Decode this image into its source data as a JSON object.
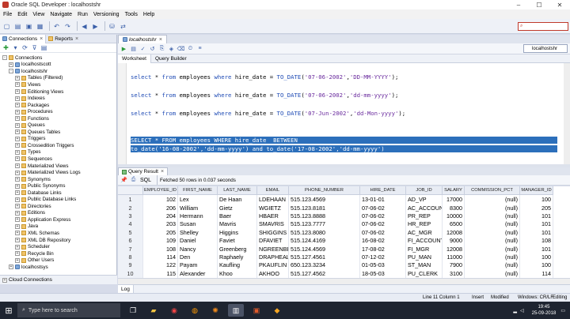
{
  "window": {
    "title": "Oracle SQL Developer : localhostshr",
    "controls": [
      "minimize-icon",
      "maximize-icon",
      "close-icon"
    ]
  },
  "menu": [
    "File",
    "Edit",
    "View",
    "Navigate",
    "Run",
    "Versioning",
    "Tools",
    "Help"
  ],
  "search": {
    "placeholder": ""
  },
  "left_panel": {
    "tabs": [
      {
        "label": "Connections"
      },
      {
        "label": "Reports"
      }
    ],
    "tree": [
      {
        "label": "Connections",
        "level": 0,
        "expander": "-",
        "icon": "folder-icon"
      },
      {
        "label": "localhostscott",
        "level": 1,
        "expander": "+",
        "icon": "database-connection-icon"
      },
      {
        "label": "localhostshr",
        "level": 1,
        "expander": "-",
        "icon": "database-connection-icon"
      },
      {
        "label": "Tables (Filtered)",
        "level": 2,
        "expander": "+",
        "icon": "folder-icon"
      },
      {
        "label": "Views",
        "level": 2,
        "expander": "+",
        "icon": "folder-icon"
      },
      {
        "label": "Editioning Views",
        "level": 2,
        "expander": "+",
        "icon": "folder-icon"
      },
      {
        "label": "Indexes",
        "level": 2,
        "expander": "+",
        "icon": "folder-icon"
      },
      {
        "label": "Packages",
        "level": 2,
        "expander": "+",
        "icon": "folder-icon"
      },
      {
        "label": "Procedures",
        "level": 2,
        "expander": "+",
        "icon": "folder-icon"
      },
      {
        "label": "Functions",
        "level": 2,
        "expander": "+",
        "icon": "folder-icon"
      },
      {
        "label": "Queues",
        "level": 2,
        "expander": "+",
        "icon": "folder-icon"
      },
      {
        "label": "Queues Tables",
        "level": 2,
        "expander": "+",
        "icon": "folder-icon"
      },
      {
        "label": "Triggers",
        "level": 2,
        "expander": "+",
        "icon": "folder-icon"
      },
      {
        "label": "Crossedition Triggers",
        "level": 2,
        "expander": "+",
        "icon": "folder-icon"
      },
      {
        "label": "Types",
        "level": 2,
        "expander": "+",
        "icon": "folder-icon"
      },
      {
        "label": "Sequences",
        "level": 2,
        "expander": "+",
        "icon": "folder-icon"
      },
      {
        "label": "Materialized Views",
        "level": 2,
        "expander": "+",
        "icon": "folder-icon"
      },
      {
        "label": "Materialized Views Logs",
        "level": 2,
        "expander": "+",
        "icon": "folder-icon"
      },
      {
        "label": "Synonyms",
        "level": 2,
        "expander": "+",
        "icon": "folder-icon"
      },
      {
        "label": "Public Synonyms",
        "level": 2,
        "expander": "+",
        "icon": "folder-icon"
      },
      {
        "label": "Database Links",
        "level": 2,
        "expander": "+",
        "icon": "folder-icon"
      },
      {
        "label": "Public Database Links",
        "level": 2,
        "expander": "+",
        "icon": "folder-icon"
      },
      {
        "label": "Directories",
        "level": 2,
        "expander": "+",
        "icon": "folder-icon"
      },
      {
        "label": "Editions",
        "level": 2,
        "expander": "+",
        "icon": "folder-icon"
      },
      {
        "label": "Application Express",
        "level": 2,
        "expander": "+",
        "icon": "folder-icon"
      },
      {
        "label": "Java",
        "level": 2,
        "expander": "+",
        "icon": "folder-icon"
      },
      {
        "label": "XML Schemas",
        "level": 2,
        "expander": "+",
        "icon": "folder-icon"
      },
      {
        "label": "XML DB Repository",
        "level": 2,
        "expander": "+",
        "icon": "folder-icon"
      },
      {
        "label": "Scheduler",
        "level": 2,
        "expander": "+",
        "icon": "folder-icon"
      },
      {
        "label": "Recycle Bin",
        "level": 2,
        "expander": "+",
        "icon": "folder-icon"
      },
      {
        "label": "Other Users",
        "level": 2,
        "expander": "+",
        "icon": "folder-icon"
      },
      {
        "label": "localhostsys",
        "level": 1,
        "expander": "+",
        "icon": "database-connection-icon"
      }
    ],
    "bottom_label": "Cloud Connections"
  },
  "editor": {
    "tab_label": "localhostshr",
    "connection": "localhostshr",
    "subtabs": [
      "Worksheet",
      "Query Builder"
    ],
    "lines": [
      {
        "parts": [
          [
            "kw",
            "select"
          ],
          [
            "t",
            " * "
          ],
          [
            "kw",
            "from"
          ],
          [
            "t",
            " employees "
          ],
          [
            "kw",
            "where"
          ],
          [
            "t",
            " hire_date = "
          ],
          [
            "kw",
            "TO_DATE"
          ],
          [
            "t",
            "("
          ],
          [
            "str",
            "'07-06-2002'"
          ],
          [
            "t",
            ","
          ],
          [
            "str",
            "'DD-MM-YYYY'"
          ],
          [
            "t",
            ");"
          ]
        ]
      },
      {
        "parts": [
          [
            "kw",
            "select"
          ],
          [
            "t",
            " * "
          ],
          [
            "kw",
            "from"
          ],
          [
            "t",
            " employees "
          ],
          [
            "kw",
            "where"
          ],
          [
            "t",
            " hire_date = "
          ],
          [
            "kw",
            "TO_DATE"
          ],
          [
            "t",
            "("
          ],
          [
            "str",
            "'07-06-2002'"
          ],
          [
            "t",
            ","
          ],
          [
            "str",
            "'dd-mm-yyyy'"
          ],
          [
            "t",
            ");"
          ]
        ]
      },
      {
        "parts": [
          [
            "kw",
            "select"
          ],
          [
            "t",
            " * "
          ],
          [
            "kw",
            "from"
          ],
          [
            "t",
            " employees "
          ],
          [
            "kw",
            "where"
          ],
          [
            "t",
            " hire_date = "
          ],
          [
            "kw",
            "TO_DATE"
          ],
          [
            "t",
            "("
          ],
          [
            "str",
            "'07-Jun-2002'"
          ],
          [
            "t",
            ","
          ],
          [
            "str",
            "'dd-Mon-yyyy'"
          ],
          [
            "t",
            ");"
          ]
        ]
      },
      {
        "selected": true,
        "parts": [
          [
            "t",
            "SELECT * FROM employees WHERE hire_date  BETWEEN"
          ]
        ]
      },
      {
        "selected": true,
        "parts": [
          [
            "t",
            "to_date('16-08-2002','dd-mm-yyyy') and to_date('17-08-2002','dd-mm-yyyy')"
          ]
        ]
      }
    ]
  },
  "results": {
    "tab_label": "Query Result",
    "toolbar_sql": "SQL",
    "status": "Fetched 50 rows in 0.037 seconds",
    "columns": [
      "EMPLOYEE_ID",
      "FIRST_NAME",
      "LAST_NAME",
      "EMAIL",
      "PHONE_NUMBER",
      "HIRE_DATE",
      "JOB_ID",
      "SALARY",
      "COMMISSION_PCT",
      "MANAGER_ID"
    ],
    "rows": [
      [
        "1",
        "102",
        "Lex",
        "De Haan",
        "LDEHAAN",
        "515.123.4569",
        "13-01-01",
        "AD_VP",
        "17000",
        "(null)",
        "100"
      ],
      [
        "2",
        "206",
        "William",
        "Gietz",
        "WGIETZ",
        "515.123.8181",
        "07-06-02",
        "AC_ACCOUNT",
        "8300",
        "(null)",
        "205"
      ],
      [
        "3",
        "204",
        "Hermann",
        "Baer",
        "HBAER",
        "515.123.8888",
        "07-06-02",
        "PR_REP",
        "10000",
        "(null)",
        "101"
      ],
      [
        "4",
        "203",
        "Susan",
        "Mavris",
        "SMAVRIS",
        "515.123.7777",
        "07-06-02",
        "HR_REP",
        "6500",
        "(null)",
        "101"
      ],
      [
        "5",
        "205",
        "Shelley",
        "Higgins",
        "SHIGGINS",
        "515.123.8080",
        "07-06-02",
        "AC_MGR",
        "12008",
        "(null)",
        "101"
      ],
      [
        "6",
        "109",
        "Daniel",
        "Faviet",
        "DFAVIET",
        "515.124.4169",
        "16-08-02",
        "FI_ACCOUNT",
        "9000",
        "(null)",
        "108"
      ],
      [
        "7",
        "108",
        "Nancy",
        "Greenberg",
        "NGREENBE",
        "515.124.4569",
        "17-08-02",
        "FI_MGR",
        "12008",
        "(null)",
        "101"
      ],
      [
        "8",
        "114",
        "Den",
        "Raphaely",
        "DRAPHEAL",
        "515.127.4561",
        "07-12-02",
        "PU_MAN",
        "11000",
        "(null)",
        "100"
      ],
      [
        "9",
        "122",
        "Payam",
        "Kaufling",
        "PKAUFLIN",
        "650.123.3234",
        "01-05-03",
        "ST_MAN",
        "7900",
        "(null)",
        "100"
      ],
      [
        "10",
        "115",
        "Alexander",
        "Khoo",
        "AKHOO",
        "515.127.4562",
        "18-05-03",
        "PU_CLERK",
        "3100",
        "(null)",
        "114"
      ]
    ]
  },
  "log_tab": "Log",
  "statusbar": {
    "position": "Line 11 Column 1",
    "mode": "Insert",
    "modified": "Modified",
    "line_ending": "Windows: CR/LF",
    "editing": "Editing"
  },
  "taskbar": {
    "search_placeholder": "Type here to search",
    "time": "19:45",
    "date": "25-09-2018"
  },
  "colors": {
    "selection": "#2c6fbb",
    "keyword": "#1f4bb5",
    "string": "#6a2b9e",
    "taskbar": "#1e2430"
  }
}
